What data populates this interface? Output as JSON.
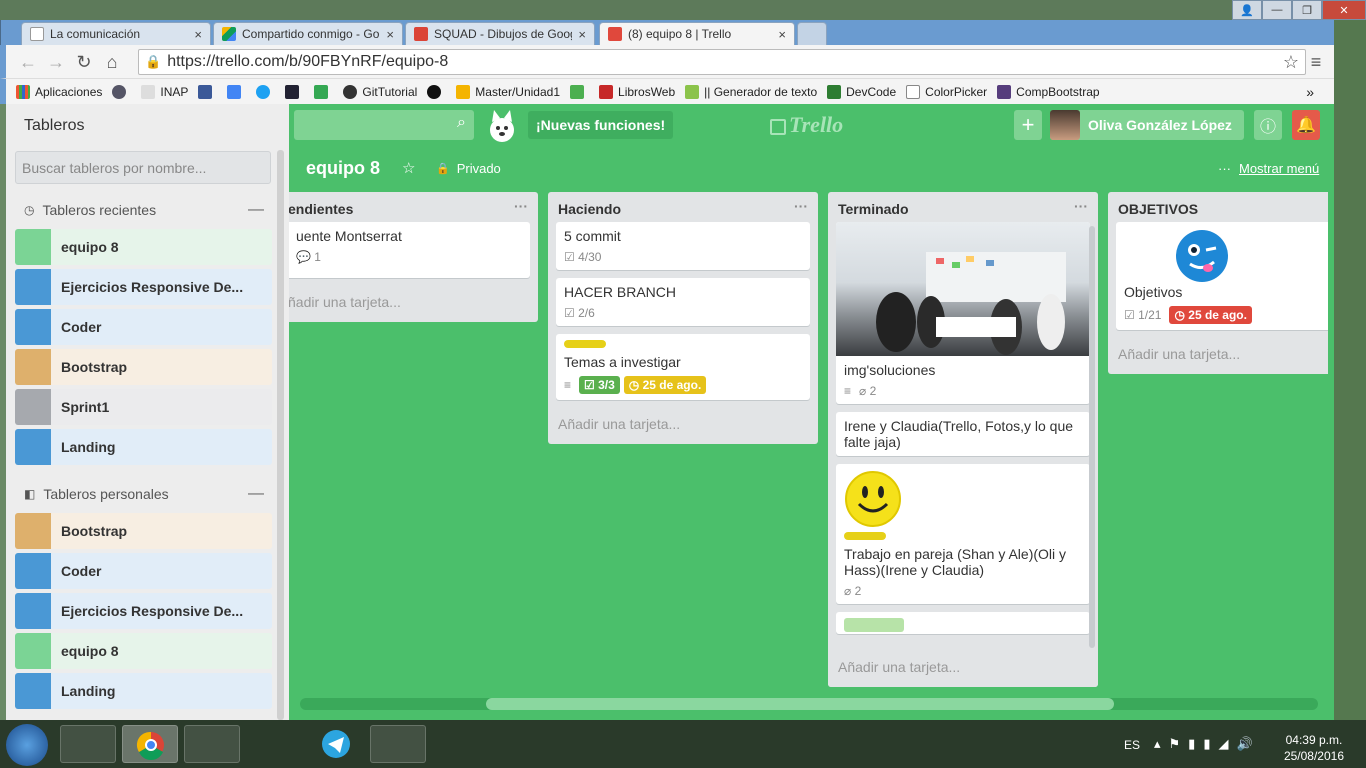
{
  "browser": {
    "tabs": [
      {
        "title": "La comunicación",
        "close": "×"
      },
      {
        "title": "Compartido conmigo - Go",
        "close": "×"
      },
      {
        "title": "SQUAD - Dibujos de Goog",
        "close": "×"
      },
      {
        "title": "(8) equipo 8 | Trello",
        "close": "×"
      }
    ],
    "url": "https://trello.com/b/90FBYnRF/equipo-8",
    "bookmarks": [
      "Aplicaciones",
      "INAP",
      "GitTutorial",
      "Master/Unidad1",
      "LibrosWeb",
      "|| Generador de texto",
      "DevCode",
      "ColorPicker",
      "CompBootstrap"
    ],
    "more_bookmarks": "»"
  },
  "header": {
    "news": "¡Nuevas funciones!",
    "logo": "Trello",
    "user": "Oliva González López",
    "add": "+",
    "info": "ⓘ",
    "bell": "🔔"
  },
  "sidebar": {
    "title": "Tableros",
    "search_placeholder": "Buscar tableros por nombre...",
    "recent_title": "Tableros recientes",
    "personal_title": "Tableros personales",
    "collapse": "—",
    "recent": [
      {
        "name": "equipo 8",
        "color": "#7bd495",
        "bg": "#e6f4ea"
      },
      {
        "name": "Ejercicios Responsive De...",
        "color": "#4a98d5",
        "bg": "#e1edf8"
      },
      {
        "name": "Coder",
        "color": "#4a98d5",
        "bg": "#e1edf8"
      },
      {
        "name": "Bootstrap",
        "color": "#deb06c",
        "bg": "#f7eee2"
      },
      {
        "name": "Sprint1",
        "color": "#a6a9ae",
        "bg": "#ebebed"
      },
      {
        "name": "Landing",
        "color": "#4a98d5",
        "bg": "#e1edf8"
      }
    ],
    "personal": [
      {
        "name": "Bootstrap",
        "color": "#deb06c",
        "bg": "#f7eee2"
      },
      {
        "name": "Coder",
        "color": "#4a98d5",
        "bg": "#e1edf8"
      },
      {
        "name": "Ejercicios Responsive De...",
        "color": "#4a98d5",
        "bg": "#e1edf8"
      },
      {
        "name": "equipo 8",
        "color": "#7bd495",
        "bg": "#e6f4ea"
      },
      {
        "name": "Landing",
        "color": "#4a98d5",
        "bg": "#e1edf8"
      }
    ]
  },
  "board": {
    "name": "equipo 8",
    "visibility": "Privado",
    "show_menu": "Mostrar menú",
    "add_card": "Añadir una tarjeta...",
    "add_card_cut": "ñadir una tarjeta...",
    "lists": [
      {
        "title": "endientes",
        "cards": [
          {
            "text": "uente Montserrat",
            "comments": "1"
          }
        ]
      },
      {
        "title": "Haciendo",
        "cards": [
          {
            "text": "5 commit",
            "checklist": "4/30"
          },
          {
            "text": "HACER BRANCH",
            "checklist": "2/6"
          },
          {
            "text": "Temas a investigar",
            "checklist": "3/3",
            "due": "25 de ago."
          }
        ]
      },
      {
        "title": "Terminado",
        "cards": [
          {
            "text": "img'soluciones",
            "attachments": "2"
          },
          {
            "text": "Irene y Claudia(Trello, Fotos,y lo que falte jaja)"
          },
          {
            "text": "Trabajo en pareja (Shan y Ale)(Oli y Hass)(Irene y Claudia)",
            "attachments": "2"
          }
        ]
      },
      {
        "title": "OBJETIVOS",
        "cards": [
          {
            "text": "Objetivos",
            "checklist": "1/21",
            "due": "25 de ago."
          }
        ]
      }
    ]
  },
  "taskbar": {
    "lang": "ES",
    "time": "04:39 p.m.",
    "date": "25/08/2016"
  },
  "colors": {
    "board_bg": "#4bbf6b",
    "due_red": "#e0483c",
    "due_yellow": "#e6c21a",
    "done_green": "#5ab04e"
  }
}
